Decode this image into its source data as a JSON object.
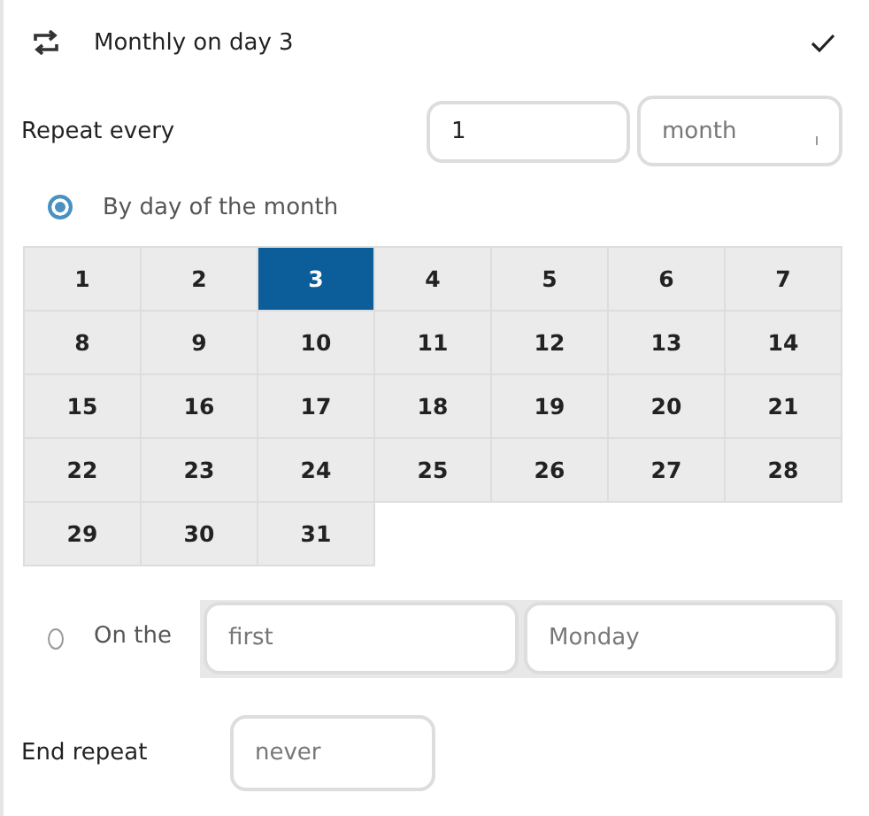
{
  "header": {
    "title": "Monthly on day 3"
  },
  "repeat_every": {
    "label": "Repeat every",
    "count": "1",
    "unit": "month"
  },
  "by_day_option": {
    "label": "By day of the month",
    "selected": true
  },
  "days": [
    {
      "label": "1",
      "selected": false
    },
    {
      "label": "2",
      "selected": false
    },
    {
      "label": "3",
      "selected": true
    },
    {
      "label": "4",
      "selected": false
    },
    {
      "label": "5",
      "selected": false
    },
    {
      "label": "6",
      "selected": false
    },
    {
      "label": "7",
      "selected": false
    },
    {
      "label": "8",
      "selected": false
    },
    {
      "label": "9",
      "selected": false
    },
    {
      "label": "10",
      "selected": false
    },
    {
      "label": "11",
      "selected": false
    },
    {
      "label": "12",
      "selected": false
    },
    {
      "label": "13",
      "selected": false
    },
    {
      "label": "14",
      "selected": false
    },
    {
      "label": "15",
      "selected": false
    },
    {
      "label": "16",
      "selected": false
    },
    {
      "label": "17",
      "selected": false
    },
    {
      "label": "18",
      "selected": false
    },
    {
      "label": "19",
      "selected": false
    },
    {
      "label": "20",
      "selected": false
    },
    {
      "label": "21",
      "selected": false
    },
    {
      "label": "22",
      "selected": false
    },
    {
      "label": "23",
      "selected": false
    },
    {
      "label": "24",
      "selected": false
    },
    {
      "label": "25",
      "selected": false
    },
    {
      "label": "26",
      "selected": false
    },
    {
      "label": "27",
      "selected": false
    },
    {
      "label": "28",
      "selected": false
    },
    {
      "label": "29",
      "selected": false
    },
    {
      "label": "30",
      "selected": false
    },
    {
      "label": "31",
      "selected": false
    }
  ],
  "on_the_option": {
    "label": "On the",
    "selected": false,
    "ordinal": "first",
    "weekday": "Monday"
  },
  "end_repeat": {
    "label": "End repeat",
    "value": "never"
  }
}
